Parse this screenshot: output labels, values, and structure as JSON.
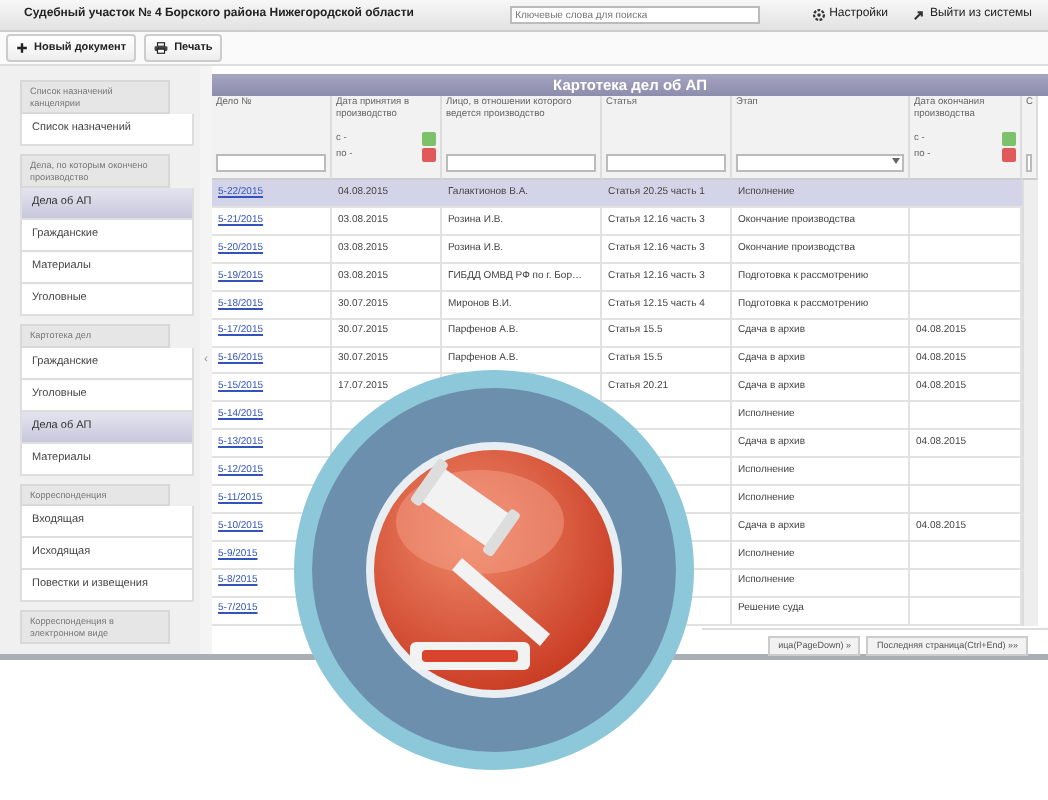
{
  "header": {
    "title": "Судебный участок № 4 Борского района Нижегородской области",
    "search": {
      "placeholder": "Ключевые слова для поиска"
    },
    "settings": "Настройки",
    "logout": "Выйти из системы"
  },
  "toolbar": [
    "Новый документ",
    "Печать"
  ],
  "sidebar": {
    "groups": [
      {
        "title": "Список назначений канцелярии",
        "items": [
          {
            "label": "Список назначений",
            "selected": false
          }
        ]
      },
      {
        "title": "Дела, по которым окончено производство",
        "items": [
          {
            "label": "Дела об АП",
            "selected": true
          },
          {
            "label": "Гражданские",
            "selected": false
          },
          {
            "label": "Материалы",
            "selected": false
          },
          {
            "label": "Уголовные",
            "selected": false
          }
        ]
      },
      {
        "title": "Картотека дел",
        "items": [
          {
            "label": "Гражданские",
            "selected": false
          },
          {
            "label": "Уголовные",
            "selected": false
          },
          {
            "label": "Дела об АП",
            "selected": true
          },
          {
            "label": "Материалы",
            "selected": false
          }
        ]
      },
      {
        "title": "Корреспонденция",
        "items": [
          {
            "label": "Входящая",
            "selected": false
          },
          {
            "label": "Исходящая",
            "selected": false
          },
          {
            "label": "Повестки и извещения",
            "selected": false
          }
        ]
      },
      {
        "title": "Корреспонденция в электронном виде"
      }
    ]
  },
  "splitter": "‹",
  "table": {
    "title": "Картотека дел об АП",
    "columns": [
      {
        "label": "Дело №",
        "kind": "text"
      },
      {
        "label": "Дата принятия в производство",
        "kind": "range",
        "from": "с -",
        "to": "по -"
      },
      {
        "label": "Лицо, в отношении которого ведется производство",
        "kind": "text"
      },
      {
        "label": "Статья",
        "kind": "text"
      },
      {
        "label": "Этап",
        "kind": "select"
      },
      {
        "label": "Дата окончания производства",
        "kind": "range",
        "from": "с -",
        "to": "по -"
      },
      {
        "label": "С",
        "kind": "text"
      }
    ],
    "rows": [
      {
        "selected": true,
        "case": "5-22/2015",
        "accepted": "04.08.2015",
        "person": "Галактионов В.А.",
        "article": "Статья 20.25 часть 1",
        "stage": "Исполнение"
      },
      {
        "selected": false,
        "case": "5-21/2015",
        "accepted": "03.08.2015",
        "person": "Розина И.В.",
        "article": "Статья 12.16 часть 3",
        "stage": "Окончание производства"
      },
      {
        "selected": false,
        "case": "5-20/2015",
        "accepted": "03.08.2015",
        "person": "Розина И.В.",
        "article": "Статья 12.16 часть 3",
        "stage": "Окончание производства"
      },
      {
        "selected": false,
        "case": "5-19/2015",
        "accepted": "03.08.2015",
        "person": "ГИБДД ОМВД РФ по г. Бор…",
        "article": "Статья 12.16 часть 3",
        "stage": "Подготовка к рассмотрению"
      },
      {
        "selected": false,
        "case": "5-18/2015",
        "accepted": "30.07.2015",
        "person": "Миронов В.И.",
        "article": "Статья 12.15 часть 4",
        "stage": "Подготовка к рассмотрению"
      },
      {
        "selected": false,
        "case": "5-17/2015",
        "accepted": "30.07.2015",
        "person": "Парфенов А.В.",
        "article": "Статья 15.5",
        "stage": "Сдача в архив",
        "ended": "04.08.2015"
      },
      {
        "selected": false,
        "case": "5-16/2015",
        "accepted": "30.07.2015",
        "person": "Парфенов А.В.",
        "article": "Статья 15.5",
        "stage": "Сдача в архив",
        "ended": "04.08.2015"
      },
      {
        "selected": false,
        "case": "5-15/2015",
        "accepted": "17.07.2015",
        "article": "Статья 20.21",
        "stage": "Сдача в архив",
        "ended": "04.08.2015"
      },
      {
        "selected": false,
        "case": "5-14/2015",
        "stage": "Исполнение"
      },
      {
        "selected": false,
        "case": "5-13/2015",
        "stage": "Сдача в архив",
        "ended": "04.08.2015"
      },
      {
        "selected": false,
        "case": "5-12/2015",
        "stage": "Исполнение"
      },
      {
        "selected": false,
        "case": "5-11/2015",
        "stage": "Исполнение"
      },
      {
        "selected": false,
        "case": "5-10/2015",
        "stage": "Сдача в архив",
        "ended": "04.08.2015"
      },
      {
        "selected": false,
        "case": "5-9/2015",
        "stage": "Исполнение"
      },
      {
        "selected": false,
        "case": "5-8/2015",
        "stage": "Исполнение"
      },
      {
        "selected": false,
        "case": "5-7/2015",
        "stage": "Решение суда"
      }
    ],
    "pager": [
      "ица(PageDown) »",
      "Последняя страница(Ctrl+End) »»"
    ]
  }
}
